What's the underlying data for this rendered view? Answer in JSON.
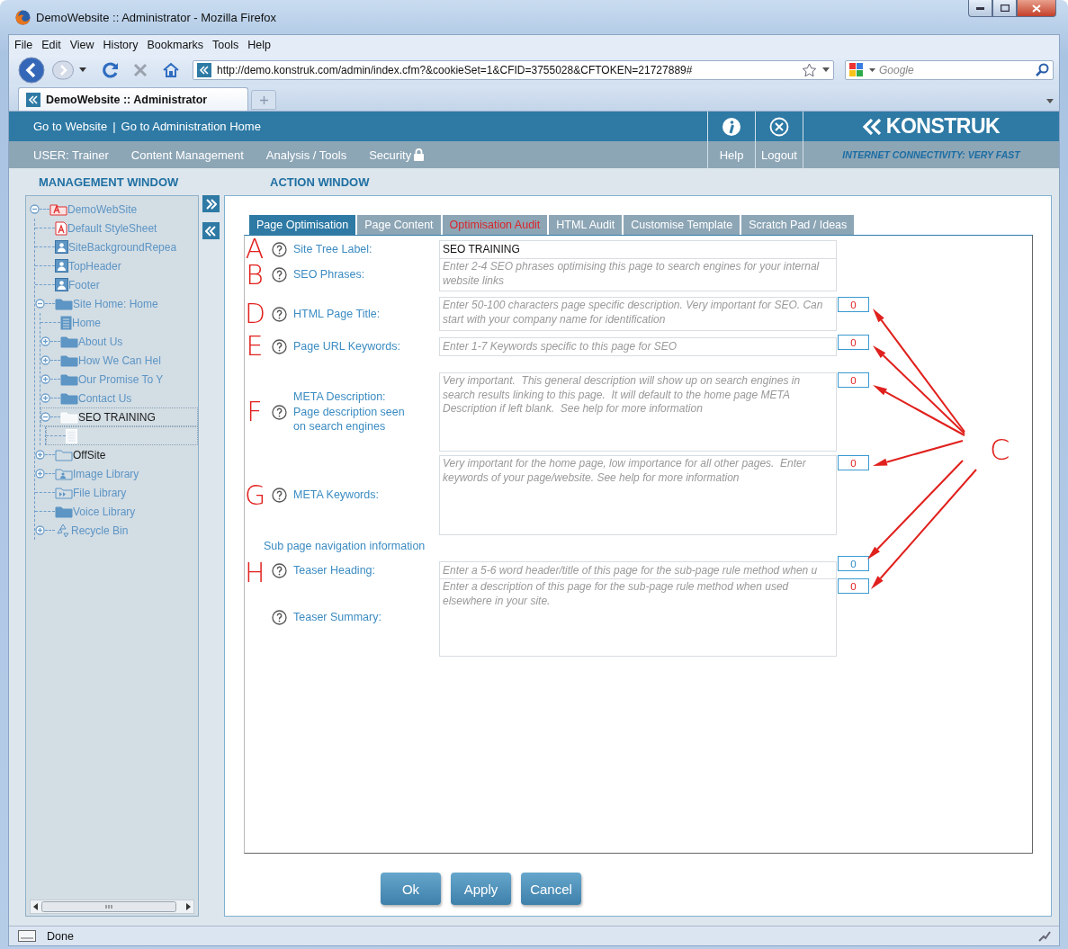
{
  "browser": {
    "title": "DemoWebsite :: Administrator - Mozilla Firefox",
    "menu": [
      "File",
      "Edit",
      "View",
      "History",
      "Bookmarks",
      "Tools",
      "Help"
    ],
    "url": "http://demo.konstruk.com/admin/index.cfm?&cookieSet=1&CFID=3755028&CFTOKEN=21727889#",
    "search_placeholder": "Google",
    "tabs": [
      {
        "label": "DemoWebsite :: Administrator",
        "selected": true
      }
    ],
    "status": "Done"
  },
  "header": {
    "links": [
      "Go to Website",
      "|",
      "Go to Administration Home"
    ],
    "nav": [
      "USER: Trainer",
      "Content Management",
      "Analysis / Tools",
      "Security"
    ],
    "help": "Help",
    "logout": "Logout",
    "logo": "KONSTRUK",
    "tagline": "INTERNET CONNECTIVITY: VERY FAST"
  },
  "management": {
    "title": "MANAGEMENT WINDOW",
    "tree": [
      {
        "label": "DemoWebSite",
        "kind": "site",
        "expanded": true,
        "selected": false,
        "children": [
          {
            "label": "Default StyleSheet",
            "kind": "stylesheet",
            "selected": false
          },
          {
            "label": "SiteBackgroundRepea",
            "kind": "image",
            "selected": false
          },
          {
            "label": "TopHeader",
            "kind": "image",
            "selected": false
          },
          {
            "label": "Footer",
            "kind": "image",
            "selected": false
          },
          {
            "label": "Site Home: Home",
            "kind": "folder",
            "expanded": true,
            "selected": false,
            "children": [
              {
                "label": "Home",
                "kind": "page",
                "selected": false
              },
              {
                "label": "About Us",
                "kind": "folder",
                "expanded": false,
                "selected": false
              },
              {
                "label": "How We Can Hel",
                "kind": "folder",
                "expanded": false,
                "selected": false
              },
              {
                "label": "Our Promise To Y",
                "kind": "folder",
                "expanded": false,
                "selected": false
              },
              {
                "label": "Contact Us",
                "kind": "folder",
                "expanded": false,
                "selected": false
              },
              {
                "label": "SEO TRAINING",
                "kind": "folder",
                "expanded": true,
                "selected": true,
                "children": [
                  {
                    "kind": "page",
                    "selected": true
                  }
                ]
              }
            ]
          },
          {
            "label": "OffSite",
            "kind": "offsite",
            "expanded": false,
            "selected": false
          },
          {
            "label": "Image Library",
            "kind": "image-library",
            "expanded": false,
            "selected": false
          },
          {
            "label": "File Library",
            "kind": "file-library",
            "selected": false
          },
          {
            "label": "Voice Library",
            "kind": "folder",
            "selected": false
          },
          {
            "label": "Recycle Bin",
            "kind": "recycle",
            "expanded": false,
            "selected": false
          }
        ]
      }
    ]
  },
  "action": {
    "title": "ACTION WINDOW",
    "tabs": [
      {
        "label": "Page Optimisation",
        "selected": true,
        "warning": false
      },
      {
        "label": "Page Content",
        "selected": false,
        "warning": false
      },
      {
        "label": "Optimisation Audit",
        "selected": false,
        "warning": true
      },
      {
        "label": "HTML Audit",
        "selected": false,
        "warning": false
      },
      {
        "label": "Customise Template",
        "selected": false,
        "warning": false
      },
      {
        "label": "Scratch Pad / Ideas",
        "selected": false,
        "warning": false
      }
    ],
    "rows": [
      {
        "kind": "input",
        "letter": "A",
        "label": "Site Tree Label:",
        "value": "SEO TRAINING"
      },
      {
        "kind": "textarea",
        "letter": "B",
        "label": "SEO Phrases:",
        "placeholder": "Enter 2-4 SEO phrases optimising this page to search engines for your internal website links"
      },
      {
        "kind": "textarea",
        "letter": "D",
        "label": "HTML Page Title:",
        "placeholder": "Enter 50-100 characters page specific description. Very important for SEO. Can start with your company name for identification",
        "counter": {
          "text": "0",
          "warning": true
        }
      },
      {
        "kind": "input",
        "letter": "E",
        "label": "Page URL Keywords:",
        "placeholder": "Enter 1-7 Keywords specific to this page for SEO",
        "counter": {
          "text": "0",
          "warning": true
        }
      },
      {
        "kind": "textarea",
        "letter": "F",
        "label": "META Description:\nPage description seen\non search engines",
        "placeholder": "Very important.  This general description will show up on search engines in search results linking to this page.  It will default to the home page META Description if left blank.  See help for more information",
        "counter": {
          "text": "0",
          "warning": true
        }
      },
      {
        "kind": "textarea",
        "letter": "G",
        "label": "META Keywords:",
        "placeholder": "Very important for the home page, low importance for all other pages.  Enter keywords of your page/website. See help for more information",
        "counter": {
          "text": "0",
          "warning": true
        }
      },
      {
        "kind": "heading",
        "label": "Sub page navigation information"
      },
      {
        "kind": "input",
        "letter": "H",
        "label": "Teaser Heading:",
        "placeholder": "Enter a 5-6 word header/title of this page for the sub-page rule method when u",
        "counter": {
          "text": "0",
          "warning": false
        }
      },
      {
        "kind": "textarea",
        "label": "Teaser Summary:",
        "placeholder": "Enter a description of this page for the sub-page rule method when used elsewhere in your site.",
        "counter": {
          "text": "0",
          "warning": true
        }
      }
    ],
    "buttons": [
      "Ok",
      "Apply",
      "Cancel"
    ]
  },
  "annotations": {
    "callout": "C"
  }
}
